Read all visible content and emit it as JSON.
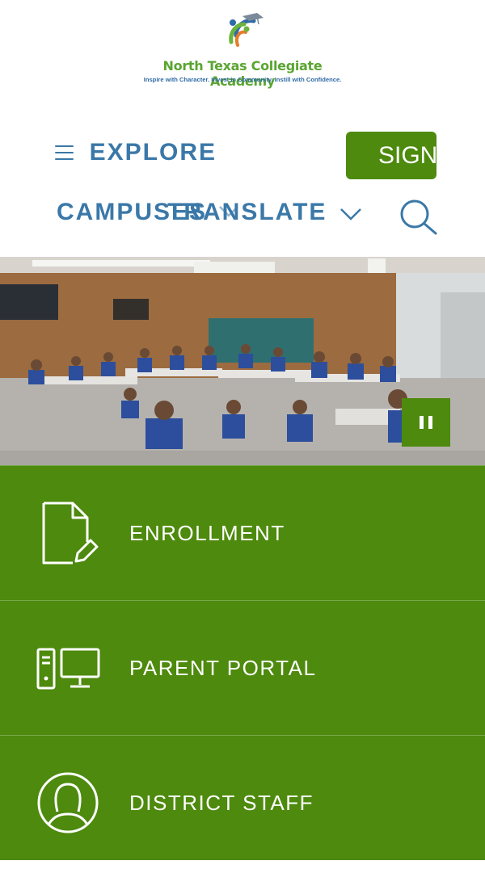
{
  "logo": {
    "name": "North Texas Collegiate Academy",
    "tagline": "Inspire with Character. Invest in Community. Instill with Confidence."
  },
  "nav": {
    "explore_label": "EXPLORE",
    "campuses_label": "CAMPUSES",
    "translate_label": "TRANSLATE",
    "signin_label": "SIGN IN"
  },
  "hero": {
    "pause_icon": "pause-icon"
  },
  "quick_links": [
    {
      "label": "ENROLLMENT",
      "icon": "document-pencil-icon"
    },
    {
      "label": "PARENT PORTAL",
      "icon": "computer-icon"
    },
    {
      "label": "DISTRICT STAFF",
      "icon": "user-circle-icon"
    }
  ],
  "colors": {
    "brand_green": "#4d8a0d",
    "nav_blue": "#3a78a8",
    "logo_green": "#5aa531"
  }
}
